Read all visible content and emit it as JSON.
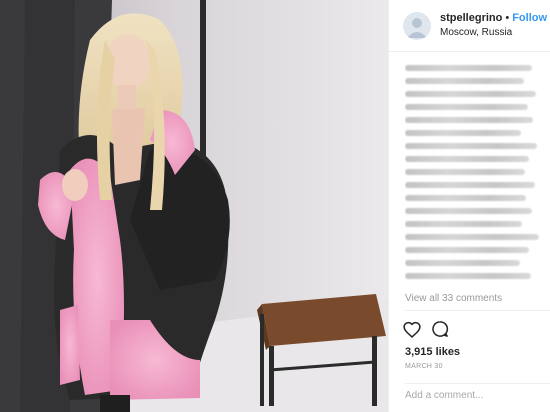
{
  "post": {
    "username": "stpellegrino",
    "separator": "•",
    "follow_label": "Follow",
    "location": "Moscow, Russia",
    "caption_lines": 19,
    "view_all_comments": "View all 33 comments",
    "likes": "3,915 likes",
    "date": "MARCH 30",
    "comment_placeholder": "Add a comment..."
  },
  "icons": {
    "like": "heart-icon",
    "comment": "comment-bubble-icon",
    "avatar": "user-avatar"
  },
  "colors": {
    "follow": "#3897f0",
    "muted": "#999999",
    "text": "#262626",
    "coat_pink": "#f3a7c9"
  }
}
